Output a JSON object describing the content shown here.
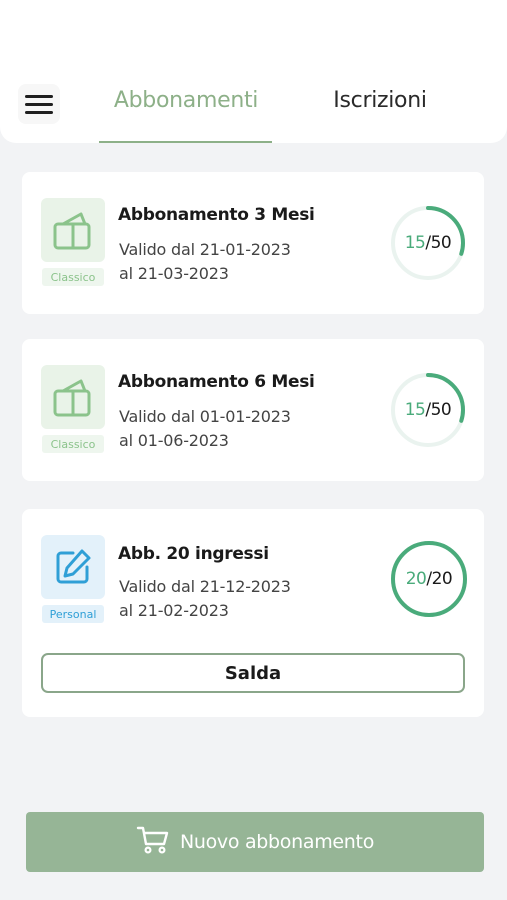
{
  "header": {
    "tabs": [
      {
        "label": "Abbonamenti",
        "active": true
      },
      {
        "label": "Iscrizioni",
        "active": false
      }
    ]
  },
  "subscriptions": [
    {
      "title": "Abbonamento 3 Mesi",
      "valid_from": "Valido dal 21-01-2023",
      "valid_to": "al 21-03-2023",
      "tag": "Classico",
      "icon": "bag-icon",
      "used": "15",
      "separator": "/",
      "total": "50",
      "progress": 0.3
    },
    {
      "title": "Abbonamento 6 Mesi",
      "valid_from": "Valido dal 01-01-2023",
      "valid_to": "al 01-06-2023",
      "tag": "Classico",
      "icon": "bag-icon",
      "used": "15",
      "separator": "/",
      "total": "50",
      "progress": 0.3
    },
    {
      "title": "Abb. 20 ingressi",
      "valid_from": "Valido dal 21-12-2023",
      "valid_to": "al 21-02-2023",
      "tag": "Personal",
      "icon": "edit-icon",
      "used": "20",
      "separator": "/",
      "total": "20",
      "progress": 1.0,
      "pay_label": "Salda"
    }
  ],
  "footer": {
    "new_subscription_label": "Nuovo abbonamento",
    "icon": "cart-icon"
  },
  "colors": {
    "accent": "#8db088",
    "ring": "#4aab7b",
    "classico_tag": "#8bc38b",
    "personal_tag": "#2f9fd6"
  }
}
